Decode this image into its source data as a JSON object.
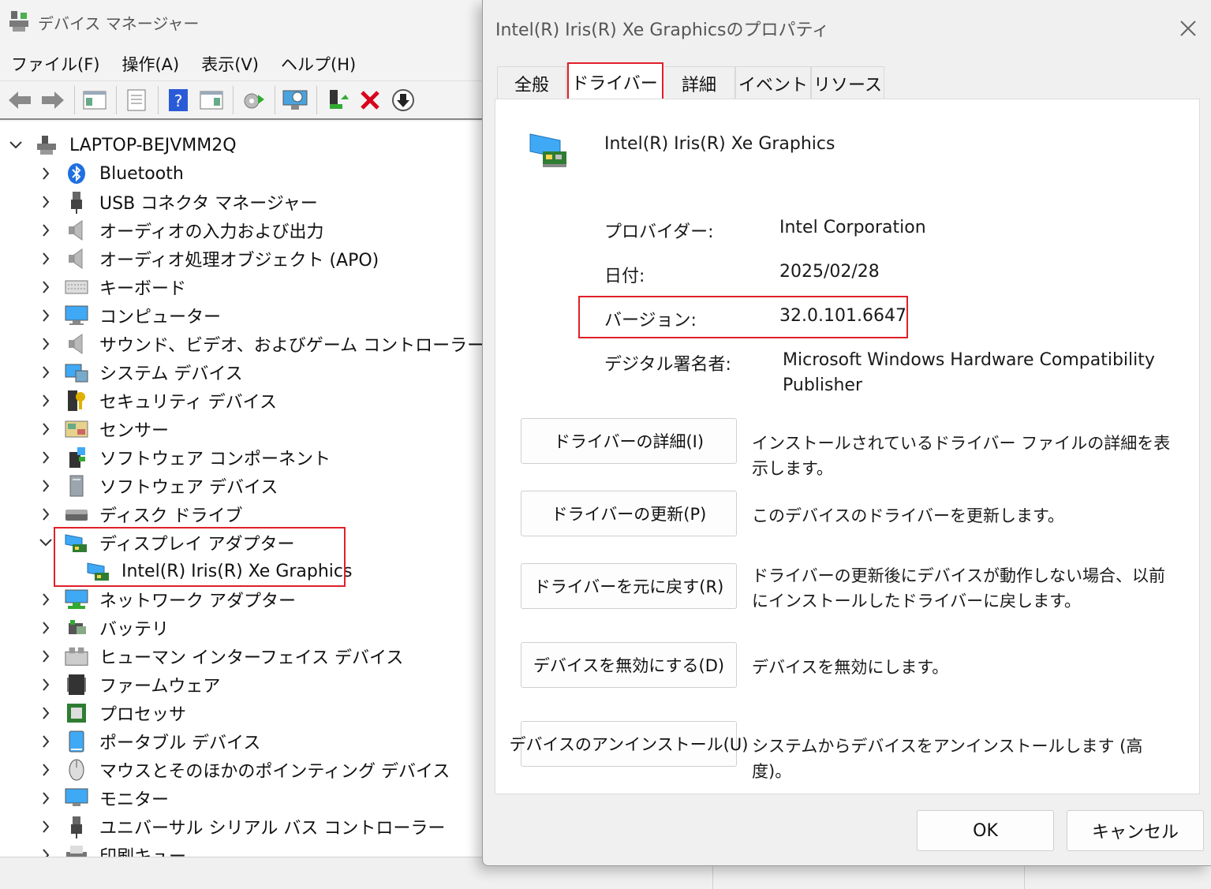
{
  "device_manager": {
    "title": "デバイス マネージャー",
    "menu": [
      "ファイル(F)",
      "操作(A)",
      "表示(V)",
      "ヘルプ(H)"
    ],
    "toolbar_icons": [
      "back-icon",
      "forward-icon",
      "console-tree-icon",
      "properties-icon",
      "help-icon",
      "action-pane-icon",
      "update-driver-icon",
      "scan-hardware-icon",
      "add-driver-icon",
      "uninstall-icon",
      "disable-icon"
    ],
    "root": "LAPTOP-BEJVMM2Q",
    "categories": [
      "Bluetooth",
      "USB コネクタ マネージャー",
      "オーディオの入力および出力",
      "オーディオ処理オブジェクト (APO)",
      "キーボード",
      "コンピューター",
      "サウンド、ビデオ、およびゲーム コントローラー",
      "システム デバイス",
      "セキュリティ デバイス",
      "センサー",
      "ソフトウェア コンポーネント",
      "ソフトウェア デバイス",
      "ディスク ドライブ",
      "ディスプレイ アダプター",
      "ネットワーク アダプター",
      "バッテリ",
      "ヒューマン インターフェイス デバイス",
      "ファームウェア",
      "プロセッサ",
      "ポータブル デバイス",
      "マウスとそのほかのポインティング デバイス",
      "モニター",
      "ユニバーサル シリアル バス コントローラー",
      "印刷キュー"
    ],
    "expanded_category": "ディスプレイ アダプター",
    "expanded_child": "Intel(R) Iris(R) Xe Graphics"
  },
  "dialog": {
    "title": "Intel(R) Iris(R) Xe Graphicsのプロパティ",
    "tabs": [
      "全般",
      "ドライバー",
      "詳細",
      "イベント",
      "リソース"
    ],
    "active_tab": "ドライバー",
    "device_name": "Intel(R) Iris(R) Xe Graphics",
    "provider_label": "プロバイダー:",
    "provider_value": "Intel Corporation",
    "date_label": "日付:",
    "date_value": "2025/02/28",
    "version_label": "バージョン:",
    "version_value": "32.0.101.6647",
    "signer_label": "デジタル署名者:",
    "signer_value_line1": "Microsoft Windows Hardware Compatibility",
    "signer_value_line2": "Publisher",
    "actions": [
      {
        "button": "ドライバーの詳細(I)",
        "desc": "インストールされているドライバー ファイルの詳細を表示します。"
      },
      {
        "button": "ドライバーの更新(P)",
        "desc": "このデバイスのドライバーを更新します。"
      },
      {
        "button": "ドライバーを元に戻す(R)",
        "desc": "ドライバーの更新後にデバイスが動作しない場合、以前にインストールしたドライバーに戻します。"
      },
      {
        "button": "デバイスを無効にする(D)",
        "desc": "デバイスを無効にします。"
      },
      {
        "button": "デバイスのアンインストール(U)",
        "desc": "システムからデバイスをアンインストールします (高度)。"
      }
    ],
    "ok_label": "OK",
    "cancel_label": "キャンセル"
  },
  "colors": {
    "highlight": "#e0202a",
    "window_bg": "#f0f0f0",
    "panel_bg": "#ffffff"
  }
}
